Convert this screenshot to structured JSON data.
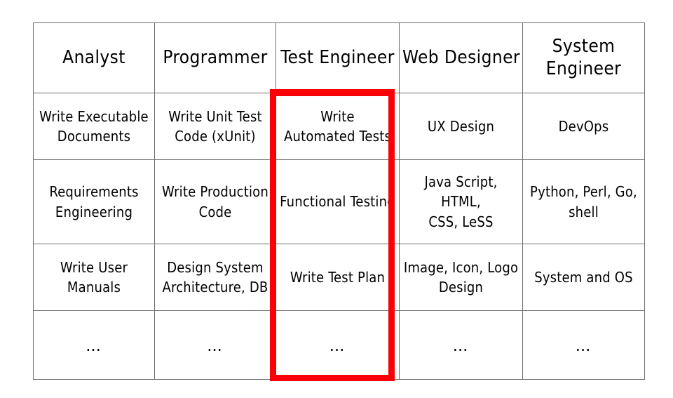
{
  "table": {
    "columns": [
      {
        "id": "analyst",
        "header": "Analyst"
      },
      {
        "id": "programmer",
        "header": "Programmer"
      },
      {
        "id": "test-engineer",
        "header": "Test Engineer"
      },
      {
        "id": "web-designer",
        "header": "Web Designer"
      },
      {
        "id": "system-engineer",
        "header_line1": "System",
        "header_line2": "Engineer"
      }
    ],
    "rows": [
      {
        "analyst": {
          "line1": "Write Executable",
          "line2": "Documents"
        },
        "programmer": {
          "line1": "Write Unit Test",
          "line2": "Code (xUnit)"
        },
        "test_engineer": {
          "line1": "Write",
          "line2": "Automated Tests"
        },
        "web_designer": {
          "line1": "UX Design",
          "line2": ""
        },
        "system_engineer": {
          "line1": "DevOps",
          "line2": ""
        }
      },
      {
        "analyst": {
          "line1": "Requirements",
          "line2": "Engineering"
        },
        "programmer": {
          "line1": "Write Production",
          "line2": "Code"
        },
        "test_engineer": {
          "line1": "Functional Testing",
          "line2": ""
        },
        "web_designer": {
          "line1": "Java Script,",
          "line2": "HTML,",
          "line3": "CSS, LeSS"
        },
        "system_engineer": {
          "line1": "Python, Perl, Go,",
          "line2": "shell"
        }
      },
      {
        "analyst": {
          "line1": "Write User",
          "line2": "Manuals"
        },
        "programmer": {
          "line1": "Design System",
          "line2": "Architecture, DB"
        },
        "test_engineer": {
          "line1": "Write Test Plan",
          "line2": ""
        },
        "web_designer": {
          "line1": "Image, Icon, Logo",
          "line2": "Design"
        },
        "system_engineer": {
          "line1": "System and OS",
          "line2": ""
        }
      },
      {
        "analyst": {
          "line1": "…",
          "line2": ""
        },
        "programmer": {
          "line1": "…",
          "line2": ""
        },
        "test_engineer": {
          "line1": "…",
          "line2": ""
        },
        "web_designer": {
          "line1": "…",
          "line2": ""
        },
        "system_engineer": {
          "line1": "…",
          "line2": ""
        }
      }
    ]
  },
  "highlight": {
    "target_column": "Test Engineer",
    "color": "#fb0007"
  },
  "colors": {
    "background": "#ffffff",
    "grid_line": "#6e6e6e",
    "text": "#000000",
    "highlight": "#fb0007"
  }
}
